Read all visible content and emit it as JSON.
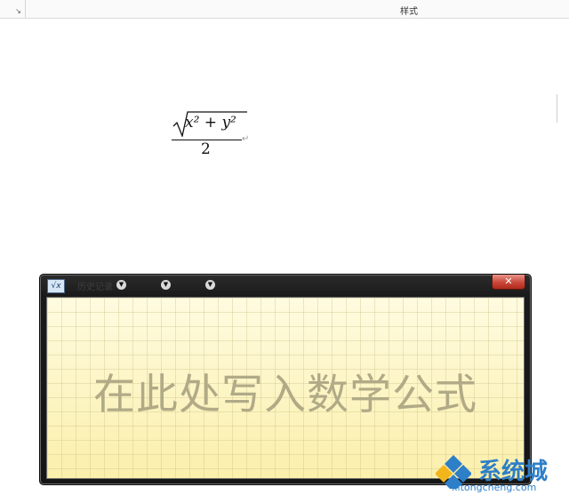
{
  "ribbon": {
    "launcher_glyph": "↘",
    "styles_group_label": "样式"
  },
  "document": {
    "equation": {
      "radicand": "x² + y²",
      "denominator": "2"
    },
    "paragraph_mark": "↵"
  },
  "math_input_panel": {
    "menu": [
      {
        "label": "历史记录"
      },
      {
        "label": ""
      },
      {
        "label": ""
      }
    ],
    "close_glyph": "✕",
    "placeholder": "在此处写入数学公式"
  },
  "watermark": {
    "text": "系统城",
    "url": "xitongcheng.com"
  },
  "colors": {
    "writing_surface": "#fcf6c6",
    "placeholder_text": "#b1aa87",
    "window_chrome": "#1a1a1a",
    "close_button": "#c9483a",
    "watermark": "#2d7fc8"
  }
}
